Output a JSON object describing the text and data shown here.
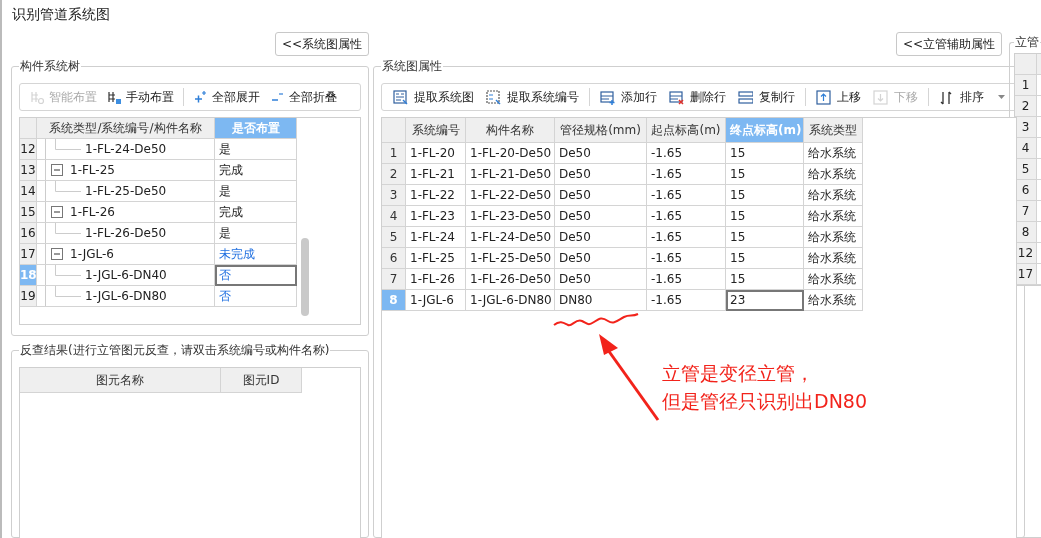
{
  "window": {
    "title": "识别管道系统图"
  },
  "tree_panel": {
    "toggle_button": "<<系统图属性",
    "title": "构件系统树",
    "toolbar": [
      {
        "label": "智能布置",
        "disabled": true
      },
      {
        "label": "手动布置",
        "disabled": false
      },
      {
        "label": "全部展开",
        "disabled": false
      },
      {
        "label": "全部折叠",
        "disabled": false
      }
    ],
    "columns": [
      {
        "label": "系统类型/系统编号/构件名称",
        "selected": false
      },
      {
        "label": "是否布置",
        "selected": true
      }
    ],
    "rows": [
      {
        "children": [
          {
            "number": "12",
            "name": "1-FL-24-De50",
            "status": "是",
            "done": true,
            "selected": false
          }
        ]
      },
      {
        "number": "13",
        "name": "1-FL-25",
        "status": "完成",
        "done": true,
        "selected": false,
        "expanded": true,
        "children": [
          {
            "number": "14",
            "name": "1-FL-25-De50",
            "status": "是",
            "done": true,
            "selected": false
          }
        ]
      },
      {
        "number": "15",
        "name": "1-FL-26",
        "status": "完成",
        "done": true,
        "selected": false,
        "expanded": true,
        "children": [
          {
            "number": "16",
            "name": "1-FL-26-De50",
            "status": "是",
            "done": true,
            "selected": false
          }
        ]
      },
      {
        "number": "17",
        "name": "1-JGL-6",
        "status": "未完成",
        "done": false,
        "selected": false,
        "expanded": true,
        "children": [
          {
            "number": "18",
            "name": "1-JGL-6-DN40",
            "status": "否",
            "done": false,
            "selected": true
          },
          {
            "number": "19",
            "name": "1-JGL-6-DN80",
            "status": "否",
            "done": false,
            "selected": false
          }
        ]
      }
    ]
  },
  "check_panel": {
    "title": "反查结果(进行立管图元反查，请双击系统编号或构件名称)",
    "columns": [
      "图元名称",
      "图元ID"
    ]
  },
  "system_panel": {
    "toggle_button": "<<立管辅助属性",
    "title": "系统图属性",
    "toolbar": [
      {
        "label": "提取系统图",
        "kind": "button",
        "disabled": false
      },
      {
        "label": "提取系统编号",
        "kind": "button",
        "disabled": false
      },
      {
        "label": "添加行",
        "kind": "button",
        "disabled": false
      },
      {
        "label": "删除行",
        "kind": "button",
        "disabled": false
      },
      {
        "label": "复制行",
        "kind": "button",
        "disabled": false
      },
      {
        "label": "上移",
        "kind": "button",
        "disabled": false
      },
      {
        "label": "下移",
        "kind": "button",
        "disabled": true
      },
      {
        "label": "排序",
        "kind": "dropdown",
        "disabled": false
      }
    ],
    "columns": [
      {
        "label": "系统编号",
        "selected": false
      },
      {
        "label": "构件名称",
        "selected": false
      },
      {
        "label": "管径规格(mm)",
        "selected": false
      },
      {
        "label": "起点标高(m)",
        "selected": false
      },
      {
        "label": "终点标高(m)",
        "selected": true
      },
      {
        "label": "系统类型",
        "selected": false
      }
    ],
    "rows": [
      {
        "number": "1",
        "cells": [
          "1-FL-20",
          "1-FL-20-De50",
          "De50",
          "-1.65",
          "15",
          "给水系统"
        ],
        "selected": false
      },
      {
        "number": "2",
        "cells": [
          "1-FL-21",
          "1-FL-21-De50",
          "De50",
          "-1.65",
          "15",
          "给水系统"
        ],
        "selected": false
      },
      {
        "number": "3",
        "cells": [
          "1-FL-22",
          "1-FL-22-De50",
          "De50",
          "-1.65",
          "15",
          "给水系统"
        ],
        "selected": false
      },
      {
        "number": "4",
        "cells": [
          "1-FL-23",
          "1-FL-23-De50",
          "De50",
          "-1.65",
          "15",
          "给水系统"
        ],
        "selected": false
      },
      {
        "number": "5",
        "cells": [
          "1-FL-24",
          "1-FL-24-De50",
          "De50",
          "-1.65",
          "15",
          "给水系统"
        ],
        "selected": false
      },
      {
        "number": "6",
        "cells": [
          "1-FL-25",
          "1-FL-25-De50",
          "De50",
          "-1.65",
          "15",
          "给水系统"
        ],
        "selected": false
      },
      {
        "number": "7",
        "cells": [
          "1-FL-26",
          "1-FL-26-De50",
          "De50",
          "-1.65",
          "15",
          "给水系统"
        ],
        "selected": false
      },
      {
        "number": "8",
        "cells": [
          "1-JGL-6",
          "1-JGL-6-DN80",
          "DN80",
          "-1.65",
          "23",
          "给水系统"
        ],
        "selected": true
      }
    ]
  },
  "annotation": {
    "lines": [
      "立管是变径立管，",
      "但是管径只识别出DN80"
    ]
  },
  "riser_panel": {
    "title": "立管",
    "row_numbers": [
      "1",
      "2",
      "3",
      "4",
      "5",
      "6",
      "7",
      "8",
      "12",
      "17"
    ]
  }
}
